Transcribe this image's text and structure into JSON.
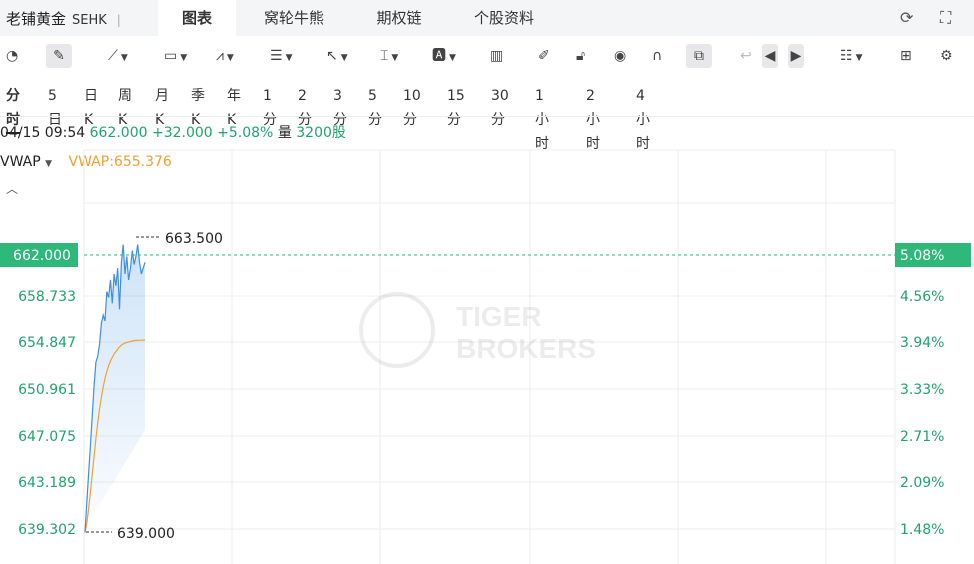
{
  "header": {
    "stock_name": "老铺黄金",
    "market": "SEHK",
    "tabs": [
      "图表",
      "窝轮牛熊",
      "期权链",
      "个股资料"
    ],
    "active_tab": 0
  },
  "periods": [
    "分时",
    "5日",
    "日K",
    "周K",
    "月K",
    "季K",
    "年K",
    "1分",
    "2分",
    "3分",
    "5分",
    "10分",
    "15分",
    "30分",
    "1小时",
    "2小时",
    "4小时"
  ],
  "info": {
    "datetime": "04/15 09:54",
    "price": "662.000",
    "change": "+32.000",
    "change_pct": "+5.08%",
    "volume_label": "量",
    "volume": "3200股"
  },
  "indicator": {
    "name": "VWAP",
    "value_text": "VWAP:655.376"
  },
  "y_axis_left": [
    "658.733",
    "654.847",
    "650.961",
    "647.075",
    "643.189",
    "639.302"
  ],
  "y_axis_right": [
    "4.56%",
    "3.94%",
    "3.33%",
    "2.71%",
    "2.09%",
    "1.48%"
  ],
  "current_price_label": "662.000",
  "current_pct_label": "5.08%",
  "high_label": "663.500",
  "low_label": "639.000",
  "watermark": "TIGER BROKERS",
  "colors": {
    "up": "#21a36b",
    "price_line": "#3d8fe0",
    "vwap_line": "#f0a030",
    "badge": "#2eb87a"
  },
  "chart_data": {
    "type": "line",
    "series": [
      {
        "name": "price",
        "values": [
          639.0,
          641.5,
          644.0,
          646.5,
          649.0,
          651.5,
          653.5,
          654.0,
          655.0,
          656.8,
          657.5,
          657.0,
          659.5,
          659.0,
          660.5,
          658.5,
          661.0,
          660.0,
          661.5,
          658.0,
          662.0,
          663.5,
          661.0,
          662.5,
          660.5,
          661.5,
          663.0,
          661.8,
          662.5,
          663.5,
          662.0,
          661.0,
          661.5,
          662.0
        ]
      },
      {
        "name": "VWAP",
        "values": [
          639.0,
          639.8,
          641.0,
          642.5,
          644.0,
          645.5,
          647.0,
          648.3,
          649.5,
          650.5,
          651.4,
          652.1,
          652.7,
          653.2,
          653.6,
          653.9,
          654.2,
          654.4,
          654.6,
          654.8,
          654.95,
          655.05,
          655.12,
          655.18,
          655.22,
          655.26,
          655.3,
          655.33,
          655.35,
          655.36,
          655.37,
          655.37,
          655.376,
          655.376
        ]
      }
    ],
    "ylim": [
      639.302,
      662.617
    ]
  }
}
